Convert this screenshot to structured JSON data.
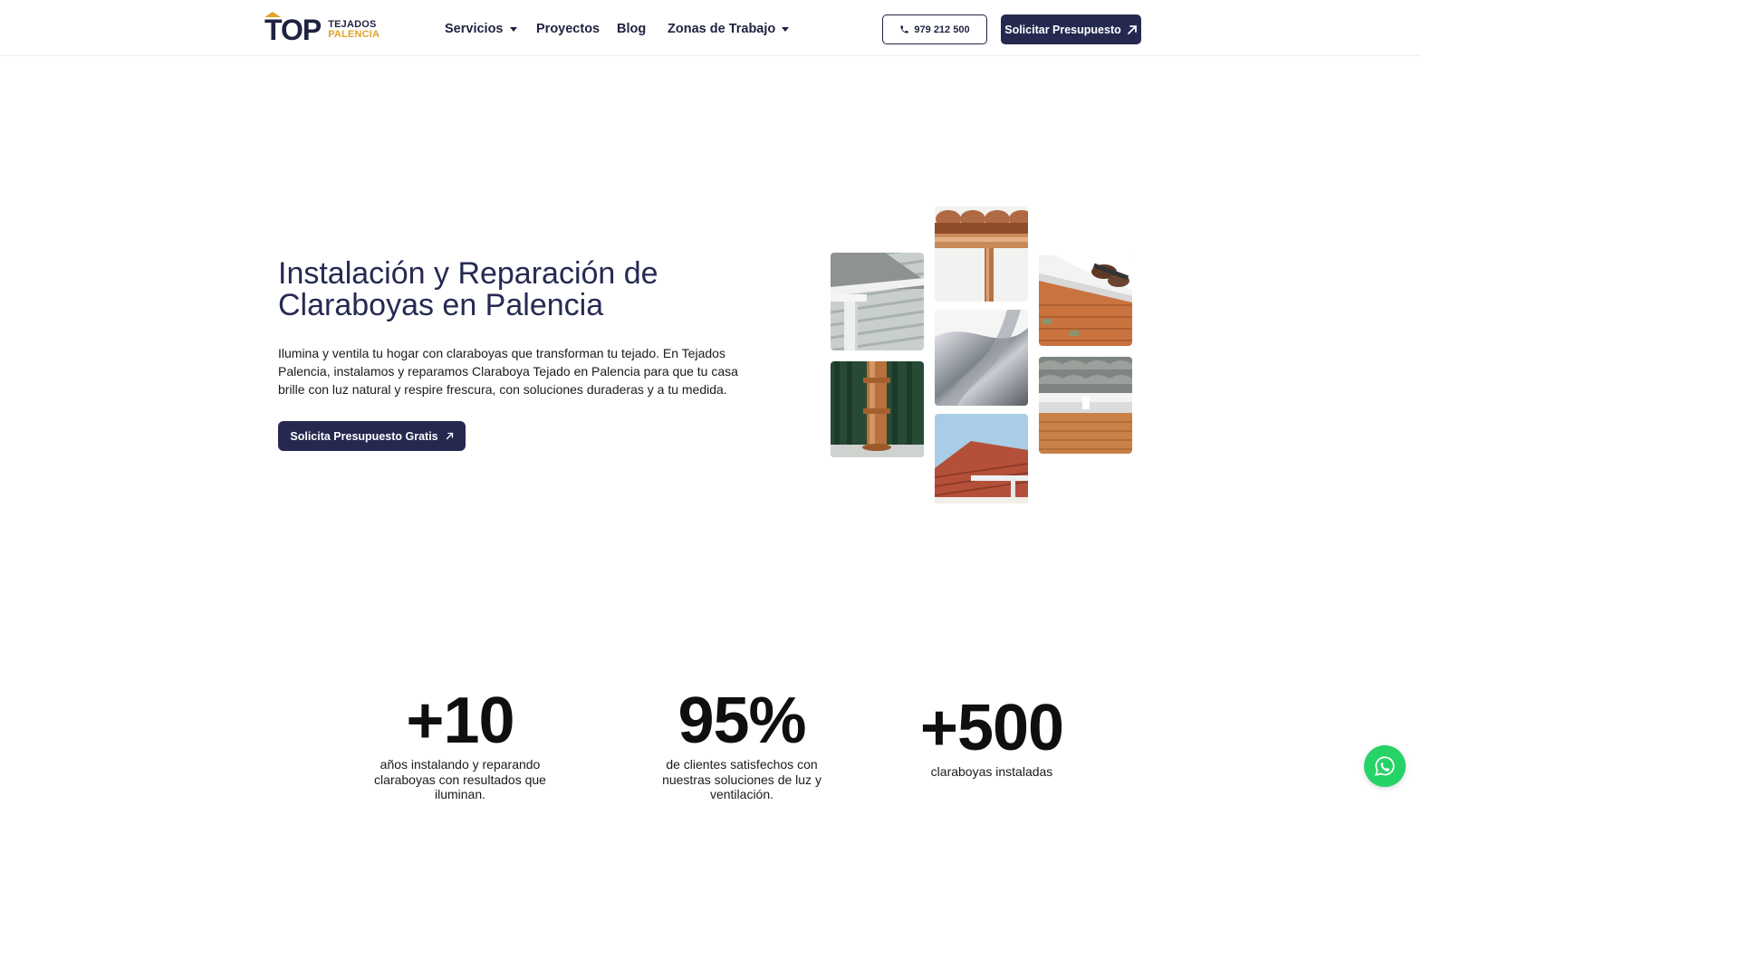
{
  "brand": {
    "logo_mark": "TOP",
    "logo_line1": "TEJADOS",
    "logo_line2": "PALENCIA",
    "primary_color": "#252950",
    "accent_color": "#e0a526"
  },
  "nav": {
    "items": [
      {
        "label": "Servicios",
        "dropdown": true
      },
      {
        "label": "Proyectos",
        "dropdown": false
      },
      {
        "label": "Blog",
        "dropdown": false
      },
      {
        "label": "Zonas de Trabajo",
        "dropdown": true
      }
    ],
    "phone_label": "979 212 500",
    "phone_icon": "phone-icon",
    "quote_label": "Solicitar Presupuesto",
    "quote_icon": "arrow-up-right-icon"
  },
  "hero": {
    "title": "Instalación y Reparación de Claraboyas en Palencia",
    "text": "Ilumina y ventila tu hogar con claraboyas que transforman tu tejado. En Tejados Palencia, instalamos y reparamos Claraboya Tejado en Palencia para que tu casa brille con luz natural y respire frescura, con soluciones duraderas y a tu medida.",
    "cta_label": "Solicita Presupuesto Gratis",
    "cta_icon": "arrow-up-right-icon"
  },
  "gallery": {
    "images": [
      "gutter-siding-photo",
      "copper-downpipe-photo",
      "copper-gutter-tiles-photo",
      "metal-gutter-closeup-photo",
      "red-roof-gutter-photo",
      "gutter-installation-photo",
      "gutter-brick-wall-photo"
    ]
  },
  "stats": [
    {
      "value": "+10",
      "label": "años instalando y reparando claraboyas con resultados que iluminan."
    },
    {
      "value": "95%",
      "label": "de clientes satisfechos con nuestras soluciones de luz y ventilación."
    },
    {
      "value": "+500",
      "label": "claraboyas instaladas"
    }
  ],
  "whatsapp": {
    "icon": "whatsapp-icon",
    "color": "#25d366"
  }
}
